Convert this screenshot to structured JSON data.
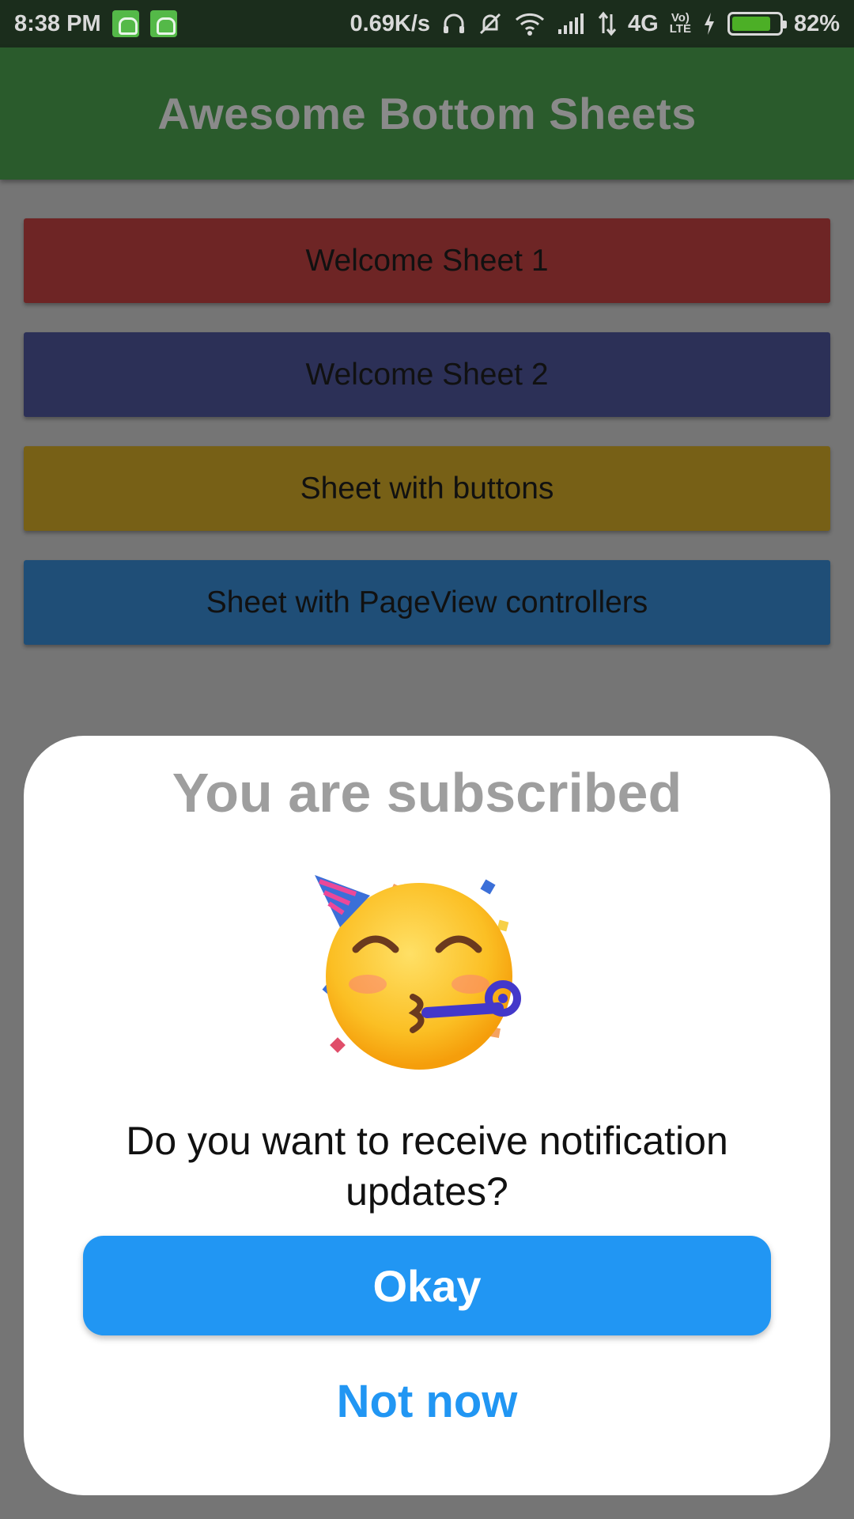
{
  "status_bar": {
    "time": "8:38 PM",
    "net_speed": "0.69K/s",
    "network_type": "4G",
    "lte_badge_top": "Vo)",
    "lte_badge_bottom": "LTE",
    "battery_percent": "82%",
    "battery_level": 0.82,
    "icons": [
      "android-notification-icon",
      "android-notification-icon",
      "headphones-icon",
      "silent-icon",
      "wifi-icon",
      "signal-icon",
      "data-arrows-icon",
      "charging-icon",
      "battery-icon"
    ]
  },
  "app_bar": {
    "title": "Awesome Bottom Sheets"
  },
  "menu": {
    "buttons": [
      {
        "label": "Welcome Sheet 1",
        "color": "#6e2525"
      },
      {
        "label": "Welcome Sheet 2",
        "color": "#2c3057"
      },
      {
        "label": "Sheet with buttons",
        "color": "#776016"
      },
      {
        "label": "Sheet with PageView controllers",
        "color": "#1f4e77"
      }
    ]
  },
  "sheet": {
    "title": "You are subscribed",
    "icon": "party-face-icon",
    "message": "Do you want to receive notification updates?",
    "primary_label": "Okay",
    "secondary_label": "Not now",
    "accent_color": "#2196f3"
  }
}
